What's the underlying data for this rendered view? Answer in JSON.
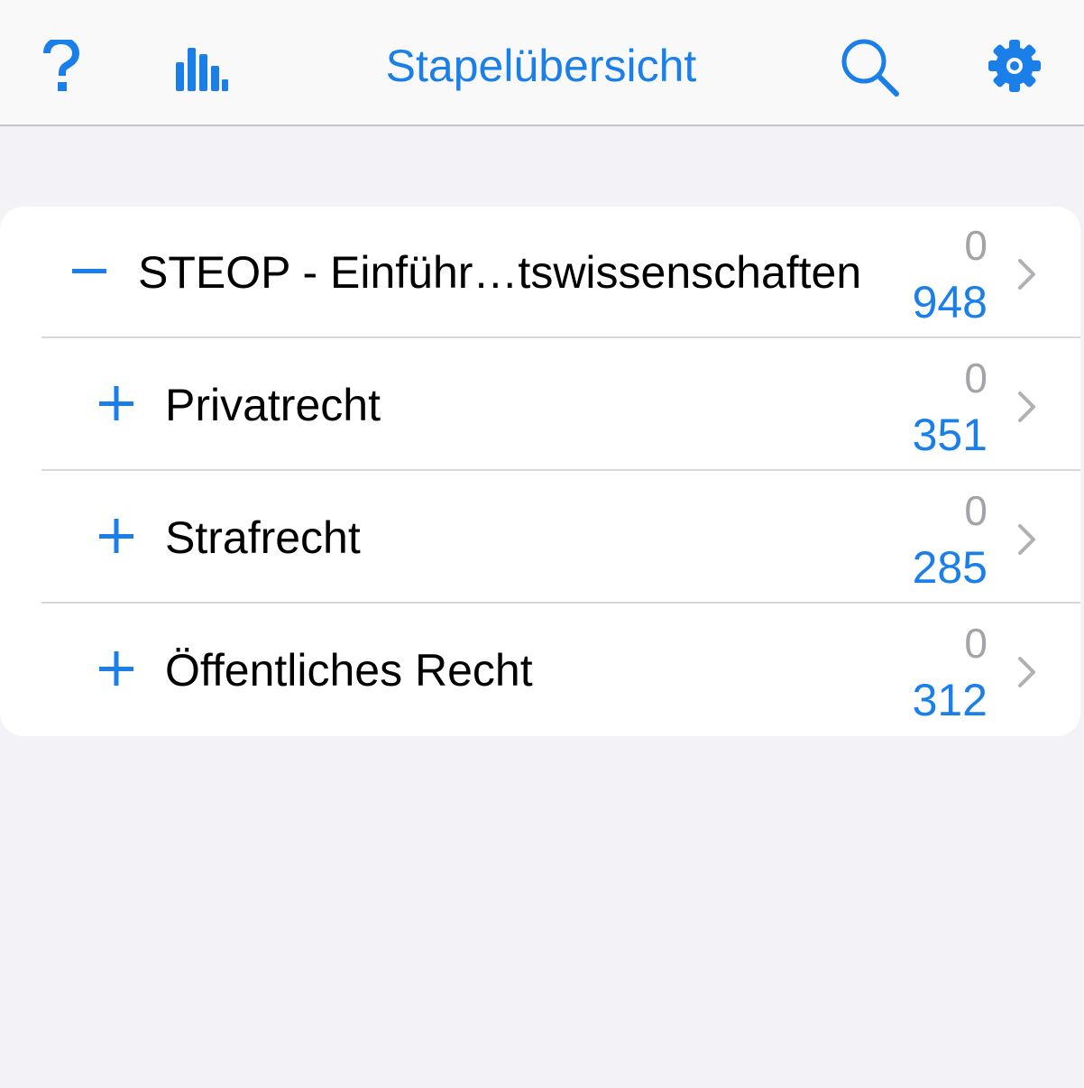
{
  "nav": {
    "title": "Stapelübersicht",
    "help_icon": "question-mark-icon",
    "stats_icon": "bar-chart-icon",
    "search_icon": "magnifying-glass-icon",
    "settings_icon": "gear-icon"
  },
  "colors": {
    "accent": "#1a7fe8",
    "background": "#f2f2f7",
    "card": "#ffffff",
    "secondary_text": "#a3a3a8",
    "separator": "#d8d8dc"
  },
  "decks": [
    {
      "name": "STEOP - Einführ…tswissenschaften",
      "toggle": "collapse",
      "due": "0",
      "total": "948"
    },
    {
      "name": "Privatrecht",
      "toggle": "expand",
      "due": "0",
      "total": "351"
    },
    {
      "name": "Strafrecht",
      "toggle": "expand",
      "due": "0",
      "total": "285"
    },
    {
      "name": "Öffentliches Recht",
      "toggle": "expand",
      "due": "0",
      "total": "312"
    }
  ]
}
